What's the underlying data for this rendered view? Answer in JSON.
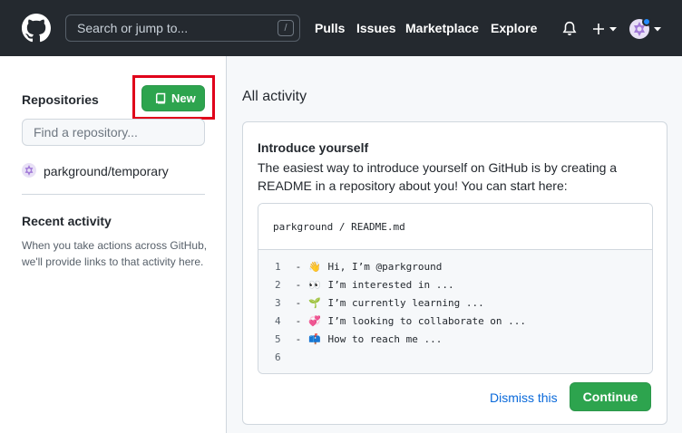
{
  "header": {
    "search_placeholder": "Search or jump to...",
    "search_shortcut": "/",
    "nav": [
      "Pulls",
      "Issues",
      "Marketplace",
      "Explore"
    ]
  },
  "sidebar": {
    "repositories_heading": "Repositories",
    "new_button_label": "New",
    "find_placeholder": "Find a repository...",
    "repos": [
      "parkground/temporary"
    ],
    "recent_heading": "Recent activity",
    "recent_description": "When you take actions across GitHub, we'll provide links to that activity here."
  },
  "main": {
    "heading": "All activity",
    "card": {
      "title": "Introduce yourself",
      "description": "The easiest way to introduce yourself on GitHub is by creating a README in a repository about you! You can start here:",
      "readme_path": "parkground / README.md",
      "lines": [
        {
          "num": "1",
          "prefix": "-",
          "emoji": "👋",
          "text": "Hi, I’m @parkground"
        },
        {
          "num": "2",
          "prefix": "-",
          "emoji": "👀",
          "text": "I’m interested in ..."
        },
        {
          "num": "3",
          "prefix": "-",
          "emoji": "🌱",
          "text": "I’m currently learning ..."
        },
        {
          "num": "4",
          "prefix": "-",
          "emoji": "💞",
          "text": "I’m looking to collaborate on ..."
        },
        {
          "num": "5",
          "prefix": "-",
          "emoji": "📫",
          "text": "How to reach me ..."
        },
        {
          "num": "6",
          "prefix": "",
          "emoji": "",
          "text": ""
        }
      ],
      "dismiss_label": "Dismiss this",
      "continue_label": "Continue"
    }
  },
  "colors": {
    "header_bg": "#24292f",
    "primary_green": "#2da44e",
    "link_blue": "#0969da",
    "highlight_red": "#e0001a"
  },
  "icons": [
    "github-logo-icon",
    "bell-icon",
    "plus-icon",
    "chevron-down-icon",
    "repo-icon",
    "identicon-avatar"
  ]
}
